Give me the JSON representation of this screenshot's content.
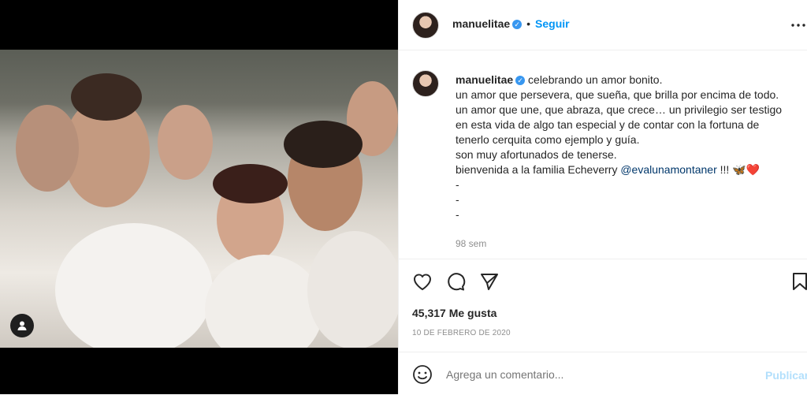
{
  "post": {
    "username": "manuelitae",
    "verified_badge": "✓",
    "follow_label": "Seguir",
    "separator": "•",
    "caption_lines": [
      "celebrando un amor bonito.",
      "un amor que persevera, que sueña, que brilla por encima de todo.",
      "un amor que une, que abraza, que crece… un privilegio ser testigo",
      "en esta vida de algo tan especial y de contar con la fortuna de",
      "tenerlo cerquita como ejemplo y guía.",
      "son muy afortunados de tenerse.",
      "bienvenida a la familia Echeverry ",
      "-",
      "-",
      "-"
    ],
    "mention": "@evalunamontaner",
    "caption_suffix": " !!! 🦋❤️",
    "time_ago": "98 sem",
    "likes": "45,317 Me gusta",
    "date": "10 DE FEBRERO DE 2020"
  },
  "comment": {
    "placeholder": "Agrega un comentario...",
    "publish_label": "Publicar"
  },
  "icons": {
    "more": "more-options-icon",
    "like": "heart-icon",
    "comment": "comment-icon",
    "share": "share-icon",
    "save": "bookmark-icon",
    "emoji": "emoji-icon",
    "user_tag": "user-tag-icon"
  },
  "colors": {
    "link": "#0095f6",
    "verified": "#3897f0",
    "mention": "#00376b",
    "muted": "#8e8e8e"
  }
}
